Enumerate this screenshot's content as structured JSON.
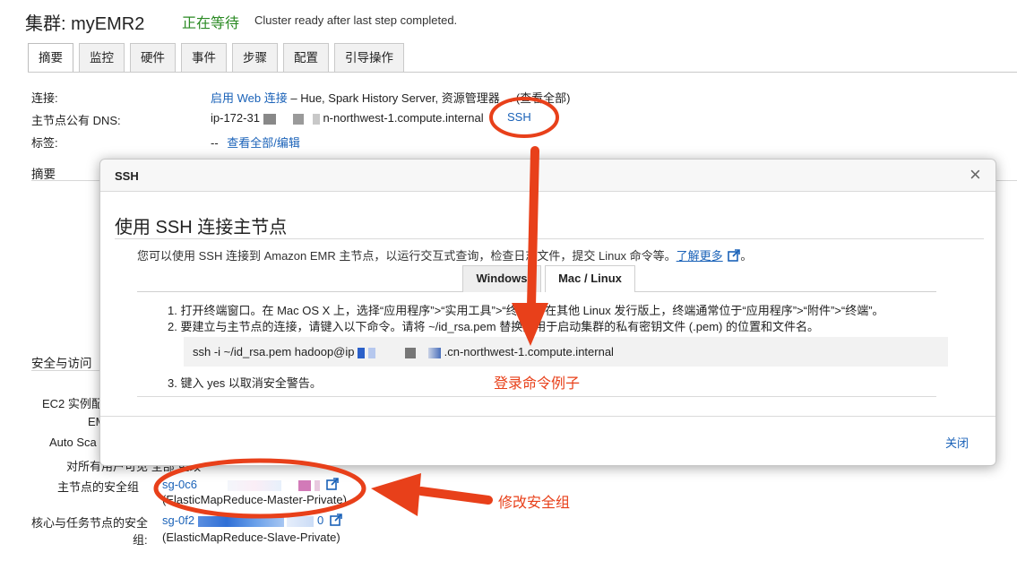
{
  "header": {
    "title": "集群: myEMR2",
    "status": "正在等待",
    "status_desc": "Cluster ready after last step completed."
  },
  "tabs": [
    {
      "label": "摘要",
      "active": true
    },
    {
      "label": "监控"
    },
    {
      "label": "硬件"
    },
    {
      "label": "事件"
    },
    {
      "label": "步骤"
    },
    {
      "label": "配置"
    },
    {
      "label": "引导操作"
    }
  ],
  "summary": {
    "connect_label": "连接:",
    "connect_link": "启用 Web 连接",
    "connect_rest": "– Hue, Spark History Server, 资源管理器 ... (查看全部)",
    "dns_label": "主节点公有 DNS:",
    "dns_prefix": "ip-172-31",
    "dns_suffix": "n-northwest-1.compute.internal",
    "ssh_link": "SSH",
    "tags_label": "标签:",
    "tags_value": "--",
    "tags_link": "查看全部/编辑",
    "section_label": "摘要"
  },
  "security": {
    "section_label": "安全与访问",
    "ec2_label": "EC2 实例配",
    "emr_label": "EM",
    "autoscale_label": "Auto Sca",
    "all_users_label": "对所有用",
    "all_users_value": "户可见 全部 更改",
    "master_sg_label": "主节点的安全组",
    "master_sg_id": "sg-0c6",
    "master_sg_name": "(ElasticMapReduce-Master-Private)",
    "slave_sg_label_1": "核心与任务节点的安全",
    "slave_sg_label_2": "组:",
    "slave_sg_id": "sg-0f2",
    "slave_sg_id_tail": "0",
    "slave_sg_name": "(ElasticMapReduce-Slave-Private)"
  },
  "modal": {
    "header_title": "SSH",
    "close_icon": "×",
    "heading": "使用 SSH 连接主节点",
    "intro_text": "您可以使用 SSH 连接到 Amazon EMR 主节点，以运行交互式查询，检查日志文件，提交 Linux 命令等。",
    "learn_more": "了解更多",
    "intro_end": "。",
    "subtabs": [
      {
        "label": "Windows"
      },
      {
        "label": "Mac / Linux",
        "active": true
      }
    ],
    "step1": "1. 打开终端窗口。在 Mac OS X 上，选择“应用程序”>“实用工具”>“终端”。在其他 Linux 发行版上，终端通常位于“应用程序”>“附件”>“终端”。",
    "step2": "2. 要建立与主节点的连接，请键入以下命令。请将 ~/id_rsa.pem 替换为用于启动集群的私有密钥文件 (.pem) 的位置和文件名。",
    "command_prefix": "ssh -i ~/id_rsa.pem hadoop@ip",
    "command_suffix": ".cn-northwest-1.compute.internal",
    "step3": "3. 键入 yes 以取消安全警告。",
    "close_button": "关闭"
  },
  "annotations": {
    "command_example": "登录命令例子",
    "modify_sg": "修改安全组",
    "color": "#e8401a"
  }
}
